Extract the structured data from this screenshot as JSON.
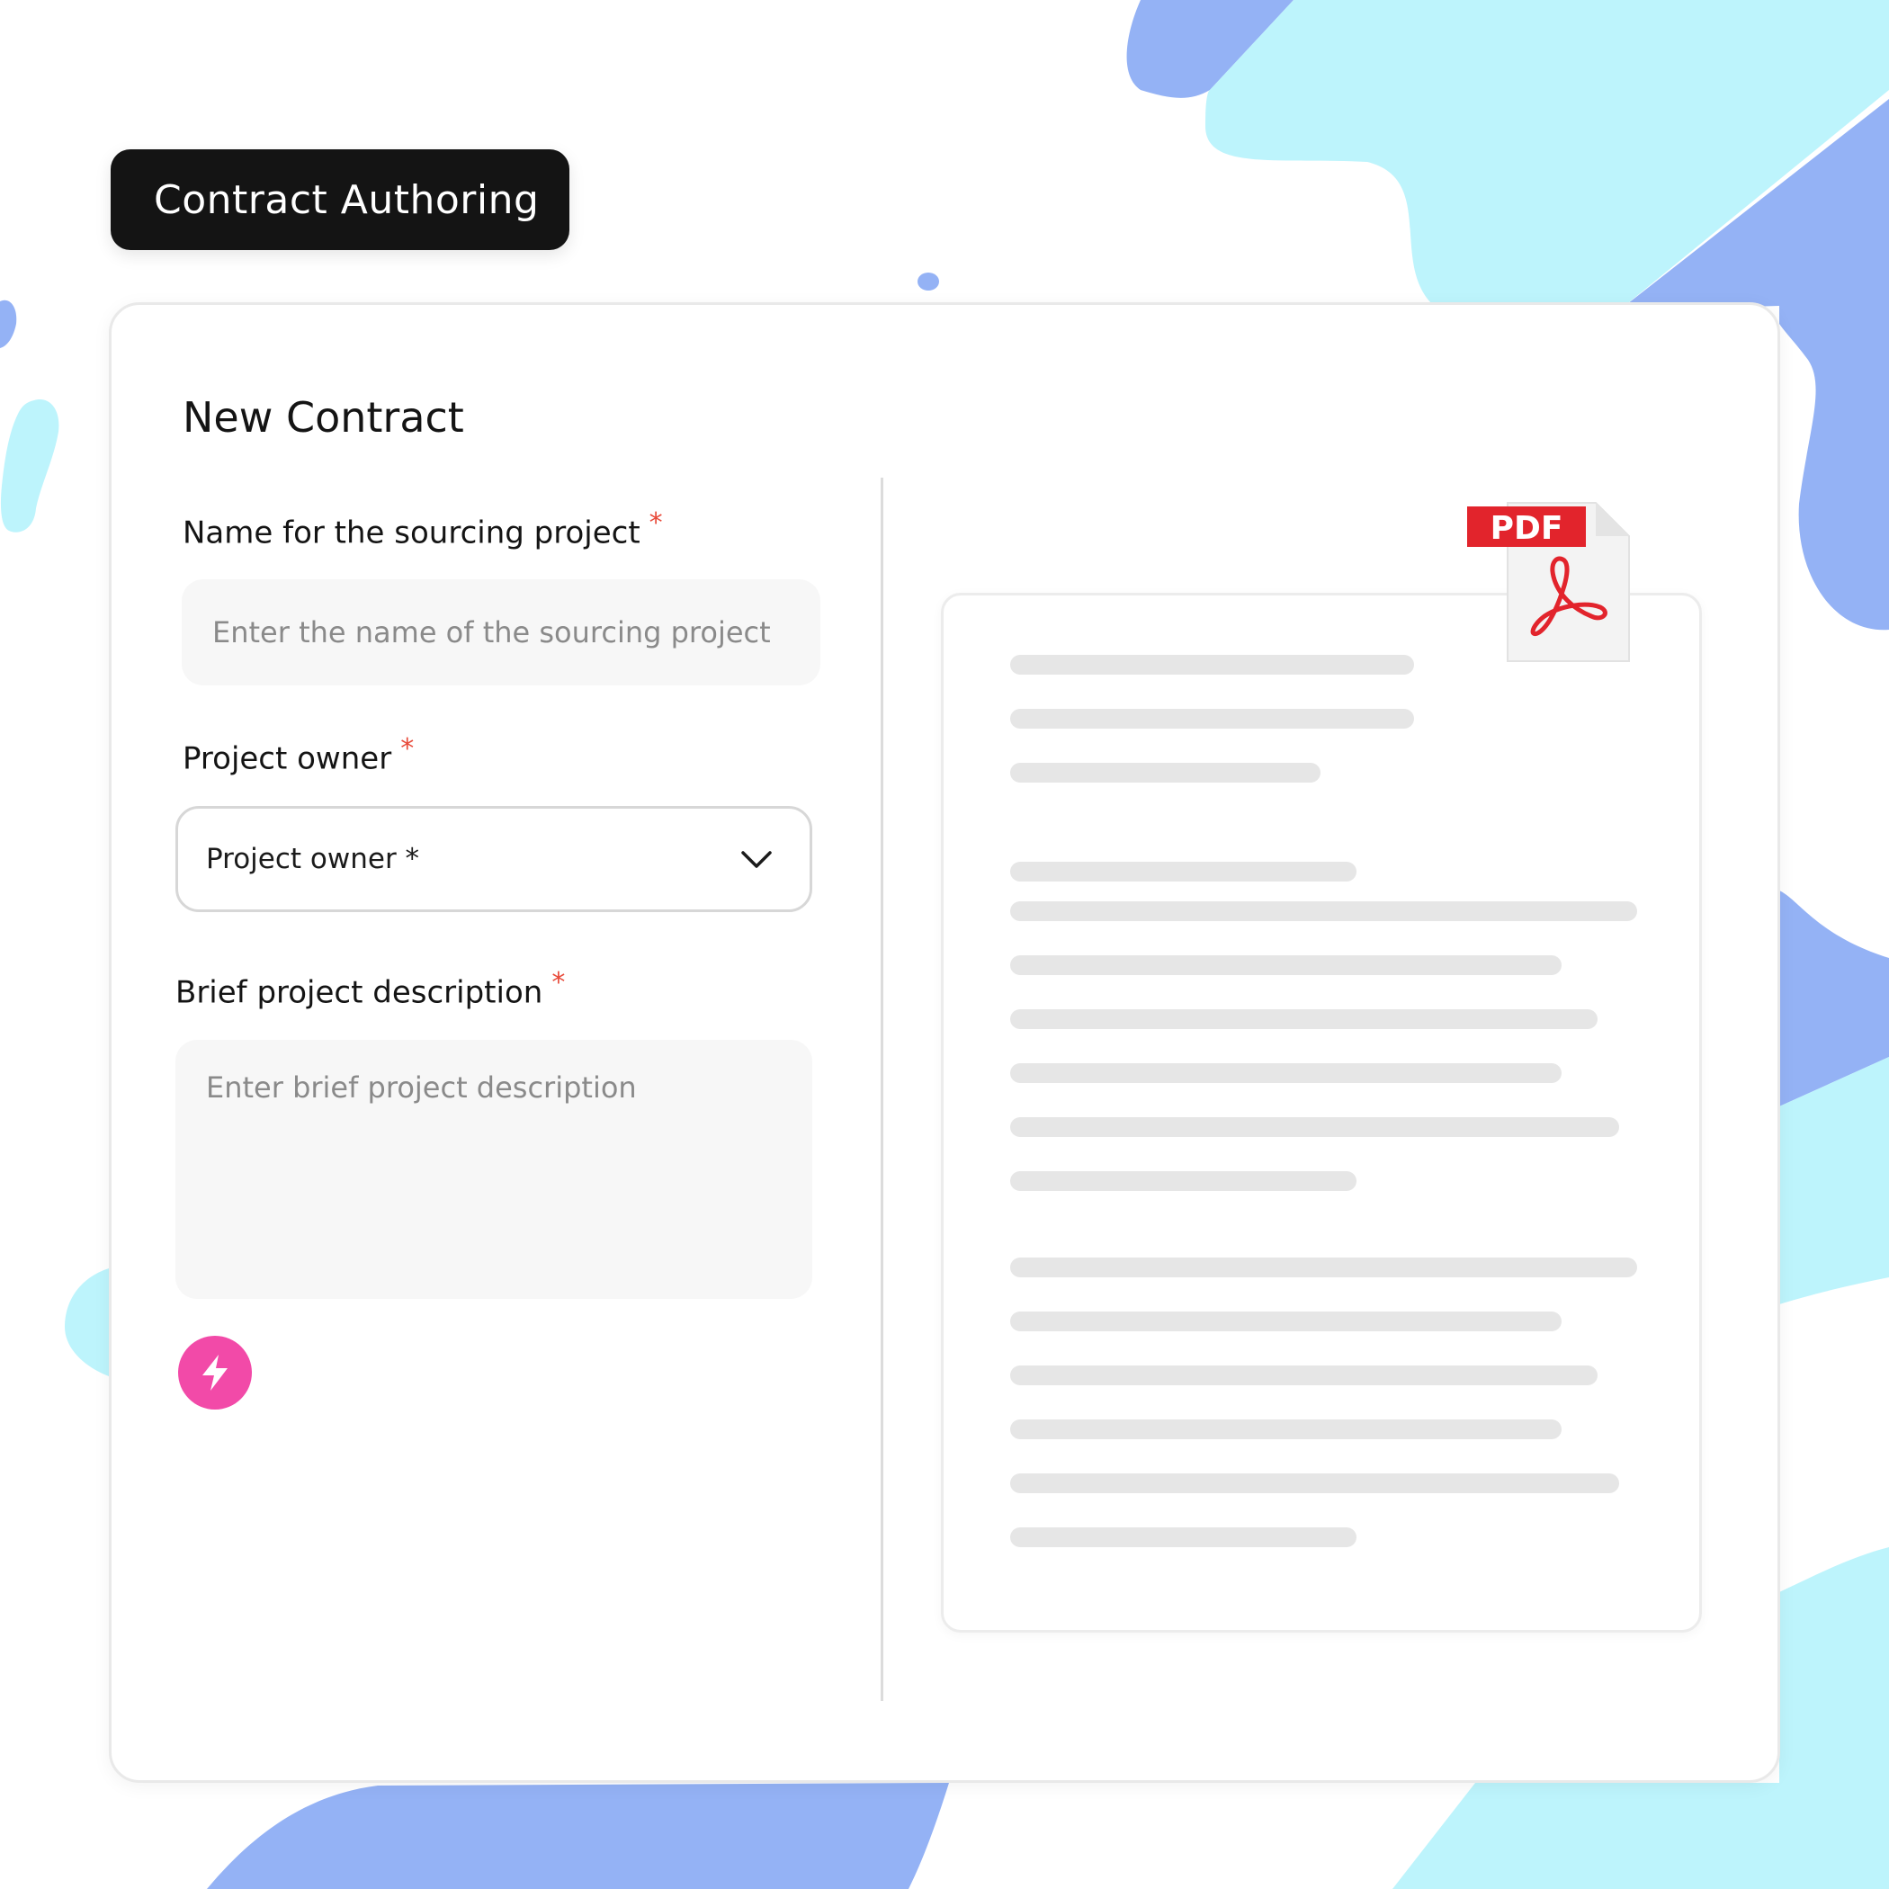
{
  "header": {
    "title": "Contract Authoring"
  },
  "form": {
    "title": "New Contract",
    "project_name": {
      "label": "Name for the sourcing project",
      "required_mark": "*",
      "placeholder": "Enter the name of the sourcing project"
    },
    "project_owner": {
      "label": "Project owner",
      "required_mark": "*",
      "selected_value": "Project owner *"
    },
    "description": {
      "label": "Brief project description",
      "required_mark": "*",
      "placeholder": "Enter brief project description"
    },
    "ai_button_icon": "lightning-bolt-icon"
  },
  "preview": {
    "file_type_label": "PDF",
    "file_icon": "adobe-pdf-icon"
  },
  "colors": {
    "badge_bg": "#141414",
    "required_mark": "#e84a3a",
    "ai_button": "#f24aa8",
    "pdf_red": "#e2242c",
    "blob_blue": "#94b2f5",
    "blob_cyan": "#bdf4fc"
  }
}
